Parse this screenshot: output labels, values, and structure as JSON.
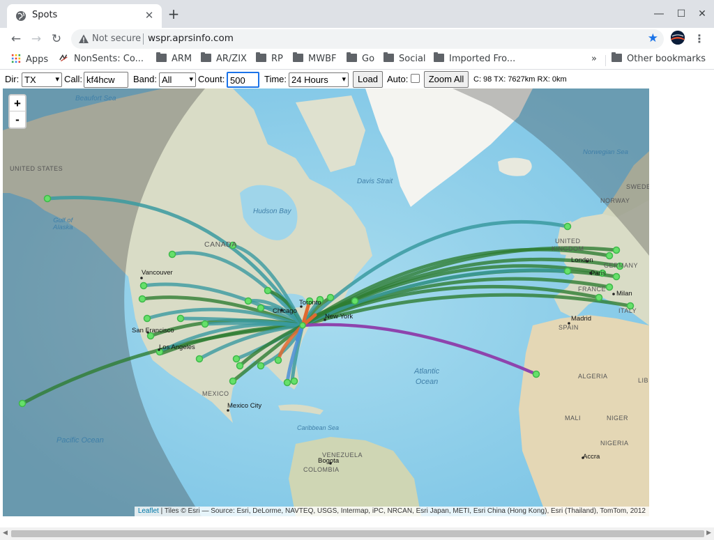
{
  "browser": {
    "tab_title": "Spots",
    "url_insecure_label": "Not secure",
    "url": "wspr.aprsinfo.com",
    "bookmarks": [
      {
        "label": "Apps",
        "icon": "apps-grid-icon"
      },
      {
        "label": "NonSents: Co...",
        "icon": "nonsents-icon"
      },
      {
        "label": "ARM",
        "icon": "folder-icon"
      },
      {
        "label": "AR/ZIX",
        "icon": "folder-icon"
      },
      {
        "label": "RP",
        "icon": "folder-icon"
      },
      {
        "label": "MWBF",
        "icon": "folder-icon"
      },
      {
        "label": "Go",
        "icon": "folder-icon"
      },
      {
        "label": "Social",
        "icon": "folder-icon"
      },
      {
        "label": "Imported Fro...",
        "icon": "folder-icon"
      }
    ],
    "more_bookmarks": "»",
    "other_bookmarks": "Other bookmarks"
  },
  "controls": {
    "dir_label": "Dir:",
    "dir_value": "TX",
    "call_label": "Call:",
    "call_value": "kf4hcw",
    "band_label": "Band:",
    "band_value": "All",
    "count_label": "Count:",
    "count_value": "500",
    "time_label": "Time:",
    "time_value": "24 Hours",
    "load_label": "Load",
    "auto_label": "Auto:",
    "auto_checked": false,
    "zoom_all_label": "Zoom All",
    "status": "C: 98 TX: 7627km RX: 0km"
  },
  "map": {
    "zoom_in": "+",
    "zoom_out": "-",
    "attribution_link": "Leaflet",
    "attribution_text": " | Tiles © Esri — Source: Esri, DeLorme, NAVTEQ, USGS, Intermap, iPC, NRCAN, Esri Japan, METI, Esri China (Hong Kong), Esri (Thailand), TomTom, 2012",
    "labels": {
      "beaufort_sea": "Beaufort Sea",
      "united_states": "UNITED STATES",
      "gulf_of_alaska": "Gulf of\nAlaska",
      "canada": "CANADA",
      "hudson_bay": "Hudson Bay",
      "davis_strait": "Davis Strait",
      "norwegian_sea": "Norwegian Sea",
      "norway": "NORWAY",
      "sweden": "SWEDE",
      "united_kingdom": "UNITED\nKINGDOM",
      "london": "London",
      "paris": "Paris",
      "germany": "GERMANY",
      "france": "FRANCE",
      "milan": "Milan",
      "italy": "ITALY",
      "madrid": "Madrid",
      "spain": "SPAIN",
      "vancouver": "Vancouver",
      "toronto": "Toronto",
      "chicago": "Chicago",
      "new_york": "New York",
      "san_francisco": "San Francisco",
      "los_angeles": "Los Angeles",
      "mexico": "MEXICO",
      "mexico_city": "Mexico City",
      "atlantic_ocean": "Atlantic\nOcean",
      "pacific_ocean": "Pacific Ocean",
      "caribbean_sea": "Caribbean Sea",
      "algeria": "ALGERIA",
      "mali": "MALI",
      "niger": "NIGER",
      "nigeria": "NIGERIA",
      "accra": "Accra",
      "venezuela": "VENEZUELA",
      "bogota": "Bogota",
      "colombia": "COLOMBIA",
      "libya": "LIB"
    },
    "colors": {
      "water": "#7fc6e6",
      "land": "#d9dcc6",
      "night_shade": "rgba(60,60,60,0.35)",
      "path_green": "#2e7d32",
      "path_teal": "#3a9aa0",
      "path_blue": "#4a8fd6",
      "path_purple": "#8e44ad",
      "path_orange": "#e06a30",
      "spot_marker": "#66e06a"
    }
  }
}
